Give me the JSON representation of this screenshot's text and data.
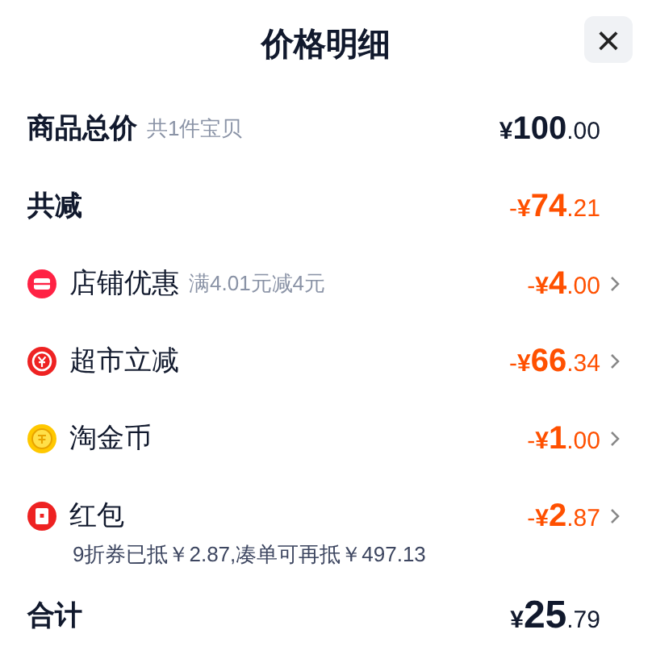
{
  "header": {
    "title": "价格明细",
    "close": "×"
  },
  "rows": [
    {
      "kind": "summary",
      "label": "商品总价",
      "note": "共1件宝贝",
      "price": {
        "currency": "¥",
        "integer": "100",
        "decimal": ".00"
      }
    },
    {
      "kind": "summary",
      "label": "共减",
      "price": {
        "sign": "-",
        "currency": "¥",
        "integer": "74",
        "decimal": ".21"
      }
    },
    {
      "kind": "discount",
      "label": "店铺优惠",
      "note": "满4.01元减4元",
      "price": {
        "sign": "-",
        "currency": "¥",
        "integer": "4",
        "decimal": ".00"
      }
    },
    {
      "kind": "discount",
      "label": "超市立减",
      "price": {
        "sign": "-",
        "currency": "¥",
        "integer": "66",
        "decimal": ".34"
      }
    },
    {
      "kind": "discount",
      "label": "淘金币",
      "price": {
        "sign": "-",
        "currency": "¥",
        "integer": "1",
        "decimal": ".00"
      }
    },
    {
      "kind": "discount",
      "label": "红包",
      "price": {
        "sign": "-",
        "currency": "¥",
        "integer": "2",
        "decimal": ".87"
      },
      "detail": "9折券已抵￥2.87,凑单可再抵￥497.13"
    }
  ],
  "total": {
    "label": "合计",
    "price": {
      "currency": "¥",
      "integer": "25",
      "decimal": ".79"
    }
  }
}
